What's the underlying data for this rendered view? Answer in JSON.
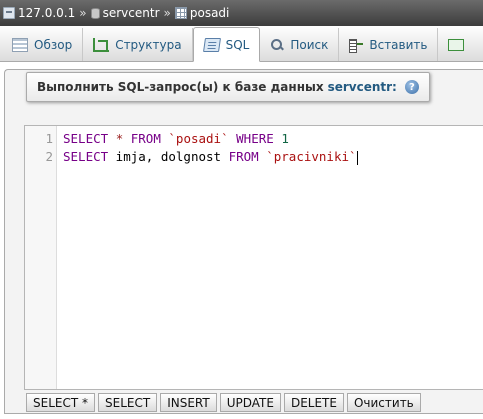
{
  "breadcrumb": {
    "server": "127.0.0.1",
    "database": "servcentr",
    "table": "posadi",
    "separator": "»"
  },
  "tabs": [
    {
      "label": "Обзор",
      "icon": "browse-icon"
    },
    {
      "label": "Структура",
      "icon": "structure-icon"
    },
    {
      "label": "SQL",
      "icon": "sql-icon",
      "active": true
    },
    {
      "label": "Поиск",
      "icon": "search-icon"
    },
    {
      "label": "Вставить",
      "icon": "insert-icon"
    },
    {
      "label": "",
      "icon": "export-icon"
    }
  ],
  "query": {
    "title": "Выполнить SQL-запрос(ы) к базе данных",
    "database": "servcentr:",
    "help_icon": "help-icon"
  },
  "editor": {
    "lines": [
      {
        "number": "1",
        "tokens": [
          {
            "text": "SELECT",
            "type": "kw"
          },
          {
            "text": " ",
            "type": "ident"
          },
          {
            "text": "*",
            "type": "op"
          },
          {
            "text": " ",
            "type": "ident"
          },
          {
            "text": "FROM",
            "type": "kw"
          },
          {
            "text": " ",
            "type": "ident"
          },
          {
            "text": "`posadi`",
            "type": "str"
          },
          {
            "text": " ",
            "type": "ident"
          },
          {
            "text": "WHERE",
            "type": "kw"
          },
          {
            "text": " ",
            "type": "ident"
          },
          {
            "text": "1",
            "type": "num"
          }
        ]
      },
      {
        "number": "2",
        "tokens": [
          {
            "text": "SELECT",
            "type": "kw"
          },
          {
            "text": " imja, dolgnost ",
            "type": "ident"
          },
          {
            "text": "FROM",
            "type": "kw"
          },
          {
            "text": " ",
            "type": "ident"
          },
          {
            "text": "`pracivniki`",
            "type": "str"
          }
        ]
      }
    ]
  },
  "buttons": [
    "SELECT *",
    "SELECT",
    "INSERT",
    "UPDATE",
    "DELETE",
    "Очистить"
  ],
  "colors": {
    "keyword": "#770088",
    "string": "#aa1111",
    "number": "#116644",
    "link": "#235a81"
  }
}
